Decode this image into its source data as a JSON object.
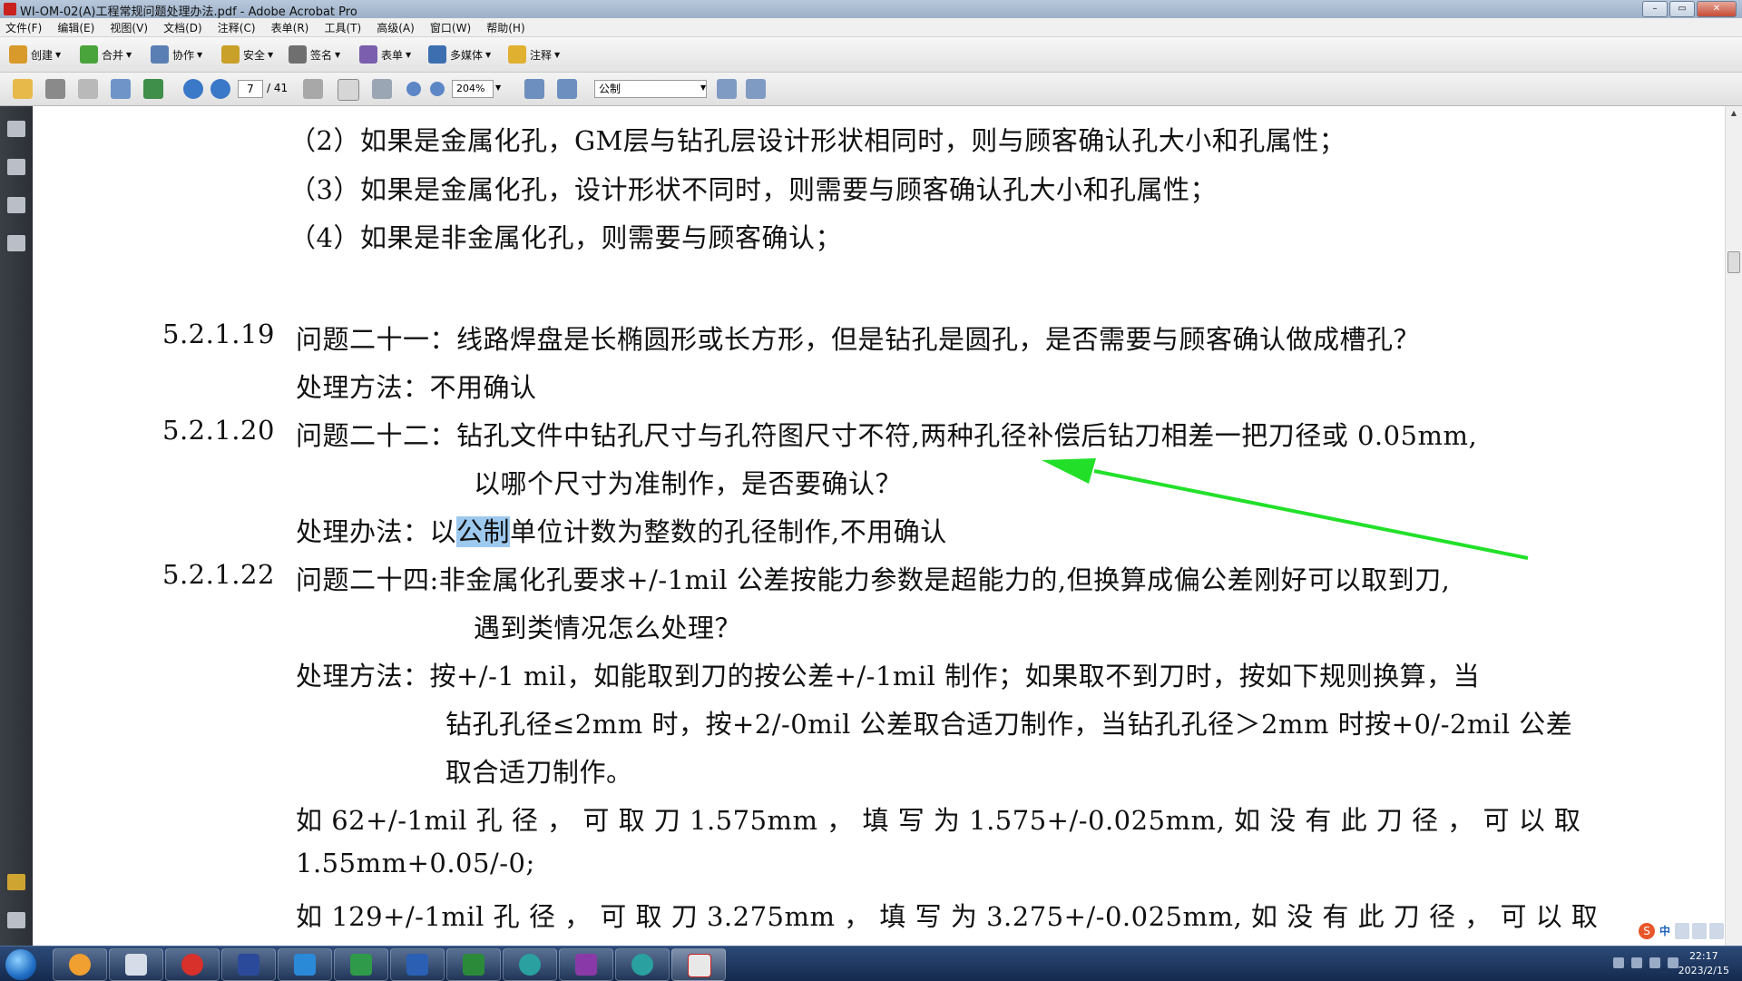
{
  "window": {
    "title": "WI-OM-02(A)工程常规问题处理办法.pdf - Adobe Acrobat Pro"
  },
  "menu": [
    "文件(F)",
    "编辑(E)",
    "视图(V)",
    "文档(D)",
    "注释(C)",
    "表单(R)",
    "工具(T)",
    "高级(A)",
    "窗口(W)",
    "帮助(H)"
  ],
  "toolbar": {
    "create": "创建",
    "combine": "合并",
    "collaborate": "协作",
    "secure": "安全",
    "sign": "签名",
    "forms": "表单",
    "multimedia": "多媒体",
    "comment": "注释"
  },
  "nav": {
    "page": "7",
    "total": "/ 41",
    "zoom": "204%",
    "search": "公制"
  },
  "doc": {
    "l1": "（2）如果是金属化孔，GM层与钻孔层设计形状相同时，则与顾客确认孔大小和孔属性；",
    "l2": "（3）如果是金属化孔，设计形状不同时，则需要与顾客确认孔大小和孔属性；",
    "l3": "（4）如果是非金属化孔，则需要与顾客确认；",
    "s19_num": "5.2.1.19",
    "s19_q": "问题二十一：线路焊盘是长椭圆形或长方形，但是钻孔是圆孔，是否需要与顾客确认做成槽孔？",
    "s19_a": "处理方法：不用确认",
    "s20_num": "5.2.1.20",
    "s20_q1": "问题二十二：钻孔文件中钻孔尺寸与孔符图尺寸不符,两种孔径补偿后钻刀相差一把刀径或 0.05mm,",
    "s20_q2": "以哪个尺寸为准制作，是否要确认？",
    "s20_a_pre": "处理办法：以",
    "s20_a_hl": "公制",
    "s20_a_post": "单位计数为整数的孔径制作,不用确认",
    "s22_num": "5.2.1.22",
    "s22_q1": "问题二十四:非金属化孔要求+/-1mil 公差按能力参数是超能力的,但换算成偏公差刚好可以取到刀,",
    "s22_q2": "遇到类情况怎么处理？",
    "s22_a1": "处理方法：按+/-1 mil，如能取到刀的按公差+/-1mil 制作；如果取不到刀时，按如下规则换算，当",
    "s22_a2": "钻孔孔径≤2mm 时，按+2/-0mil 公差取合适刀制作，当钻孔孔径＞2mm 时按+0/-2mil 公差",
    "s22_a3": "取合适刀制作。",
    "ex1a": "如 62+/-1mil 孔 径 ， 可 取 刀 1.575mm ， 填 写 为 1.575+/-0.025mm, 如 没 有 此 刀 径 ， 可 以 取",
    "ex1b": "1.55mm+0.05/-0;",
    "ex2a": "如 129+/-1mil 孔 径 ， 可 取 刀 3.275mm ， 填 写 为 3.275+/-0.025mm, 如 没 有 此 刀 径 ， 可 以 取"
  },
  "annotation": {
    "arrow_color": "#22e02a"
  },
  "ime": {
    "label": "中"
  },
  "clock": {
    "time": "22:17",
    "date": "2023/2/15"
  }
}
